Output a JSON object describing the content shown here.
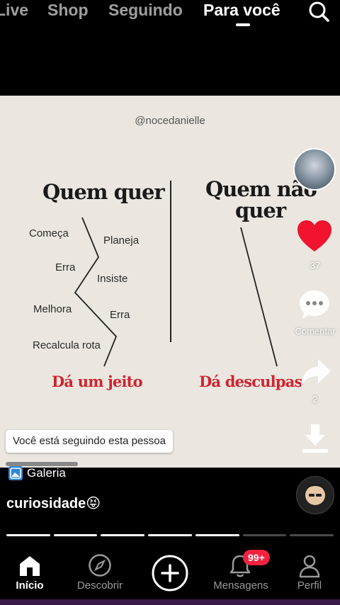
{
  "top_tabs": {
    "live": "Live",
    "shop": "Shop",
    "following": "Seguindo",
    "for_you": "Para você"
  },
  "post": {
    "handle": "@nocedanielle",
    "left_title": "Quem quer",
    "right_title_line1": "Quem não",
    "right_title_line2": "quer",
    "left_words": [
      "Começa",
      "Planeja",
      "Erra",
      "Insiste",
      "Melhora",
      "Erra",
      "Recalcula rota"
    ],
    "left_result": "Dá um jeito",
    "right_result": "Dá desculpas"
  },
  "actions": {
    "like_count": "37",
    "comment_label": "Comentar",
    "share_count": "2"
  },
  "follow_toast": "Você está seguindo esta pessoa",
  "gallery_label": "Galeria",
  "caption": "curiosidade😝",
  "bottom_nav": {
    "home": "Início",
    "discover": "Descobrir",
    "messages": "Mensagens",
    "profile": "Perfil",
    "messages_badge": "99+"
  },
  "colors": {
    "accent_red": "#d1232f",
    "like_red": "#f0142f",
    "badge_red": "#f5213f",
    "post_bg": "#ebe7e0"
  },
  "progress": {
    "segments_total": 7,
    "segments_viewed": 5
  }
}
